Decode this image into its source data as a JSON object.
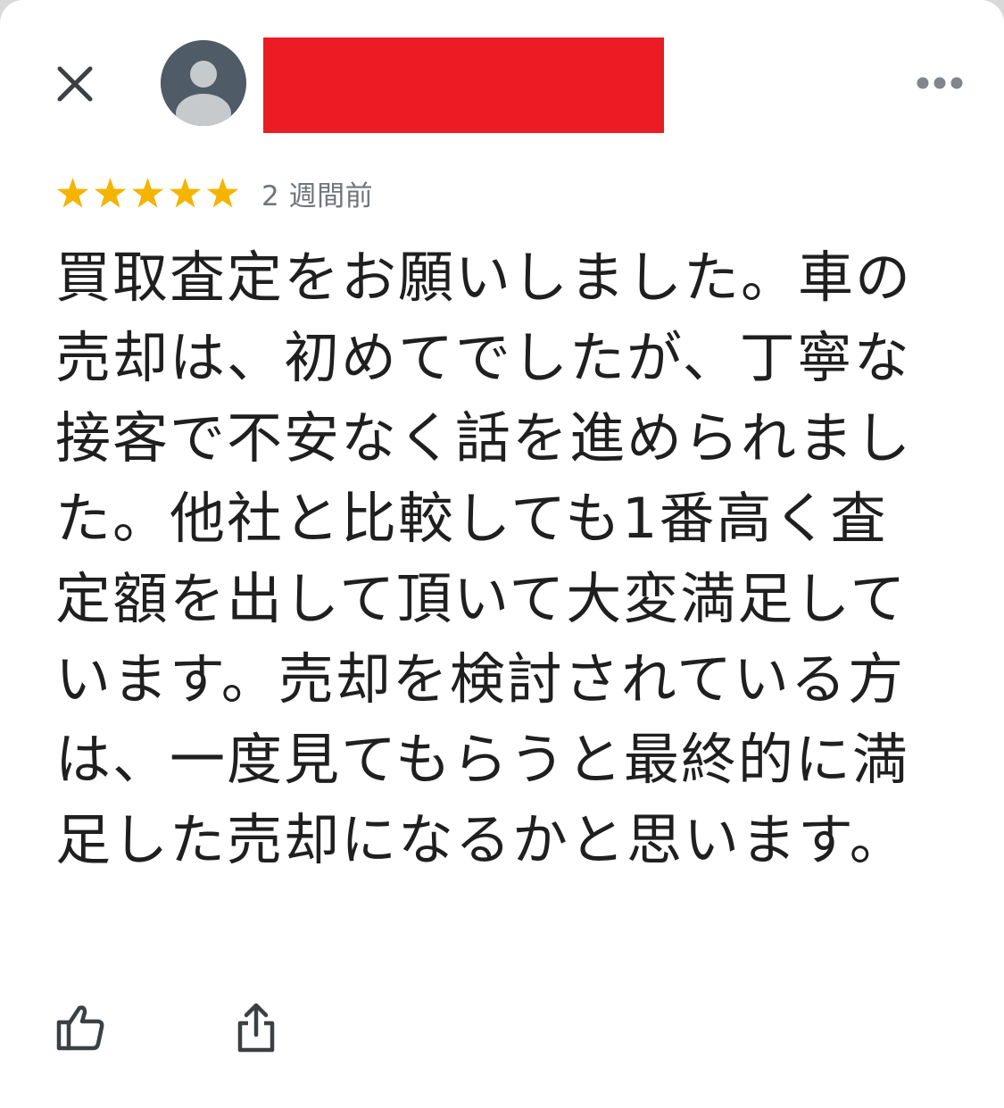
{
  "header": {
    "close_icon": "close-icon",
    "avatar_icon": "default-person-avatar",
    "more_icon": "more-horizontal-icon",
    "redaction_color": "#ec1c24"
  },
  "review": {
    "rating": 5,
    "rating_max": 5,
    "star_color": "#f4b400",
    "time_ago": "2 週間前",
    "text": "買取査定をお願いしました。車の売却は、初めてでしたが、丁寧な接客で不安なく話を進められました。他社と比較しても1番高く査定額を出して頂いて大変満足しています。売却を検討されている方は、一度見てもらうと最終的に満足した売却になるかと思います。"
  },
  "actions": {
    "like_icon": "thumb-up-icon",
    "share_icon": "share-icon"
  }
}
